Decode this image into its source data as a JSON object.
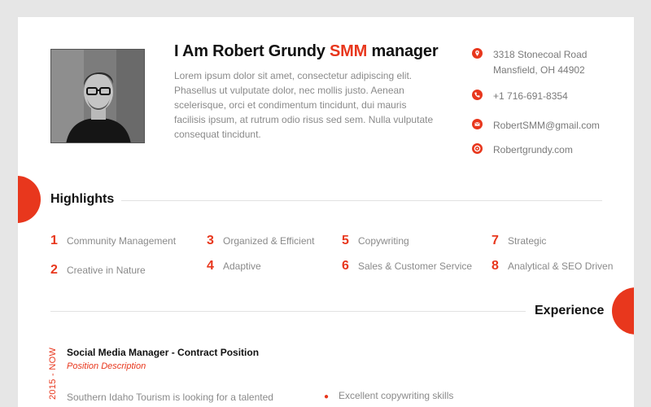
{
  "profile": {
    "name_prefix": "I Am Robert Grundy ",
    "name_accent": "SMM",
    "name_suffix": " manager",
    "bio": "Lorem ipsum dolor sit amet, consectetur adipiscing elit. Phasellus ut vulputate dolor, nec mollis justo. Aenean scelerisque, orci et condimentum tincidunt, dui mauris facilisis ipsum, at rutrum odio risus sed sem. Nulla vulputate consequat tincidunt."
  },
  "contact": {
    "address": "3318 Stonecoal Road\nMansfield, OH 44902",
    "phone": "+1 716-691-8354",
    "email": "RobertSMM@gmail.com",
    "website": "Robertgrundy.com",
    "icons": [
      "location-pin-icon",
      "phone-icon",
      "mail-icon",
      "globe-icon"
    ]
  },
  "highlights": {
    "title": "Highlights",
    "items": [
      {
        "num": "1",
        "label": "Community Management"
      },
      {
        "num": "2",
        "label": "Creative in Nature"
      },
      {
        "num": "3",
        "label": "Organized & Efficient"
      },
      {
        "num": "4",
        "label": "Adaptive"
      },
      {
        "num": "5",
        "label": "Copywriting"
      },
      {
        "num": "6",
        "label": "Sales & Customer Service"
      },
      {
        "num": "7",
        "label": "Strategic"
      },
      {
        "num": "8",
        "label": "Analytical & SEO Driven"
      }
    ]
  },
  "experience": {
    "title": "Experience",
    "years": "2015 - NOW",
    "job_title": "Social Media Manager - Contract Position",
    "job_subtitle": "Position Description",
    "description": "Southern Idaho Tourism is looking for a talented",
    "bullets": [
      "Excellent copywriting skills"
    ]
  },
  "colors": {
    "accent": "#e8371d",
    "background": "#e6e6e6",
    "sheet": "#ffffff",
    "muted_text": "#8a8a8a"
  }
}
